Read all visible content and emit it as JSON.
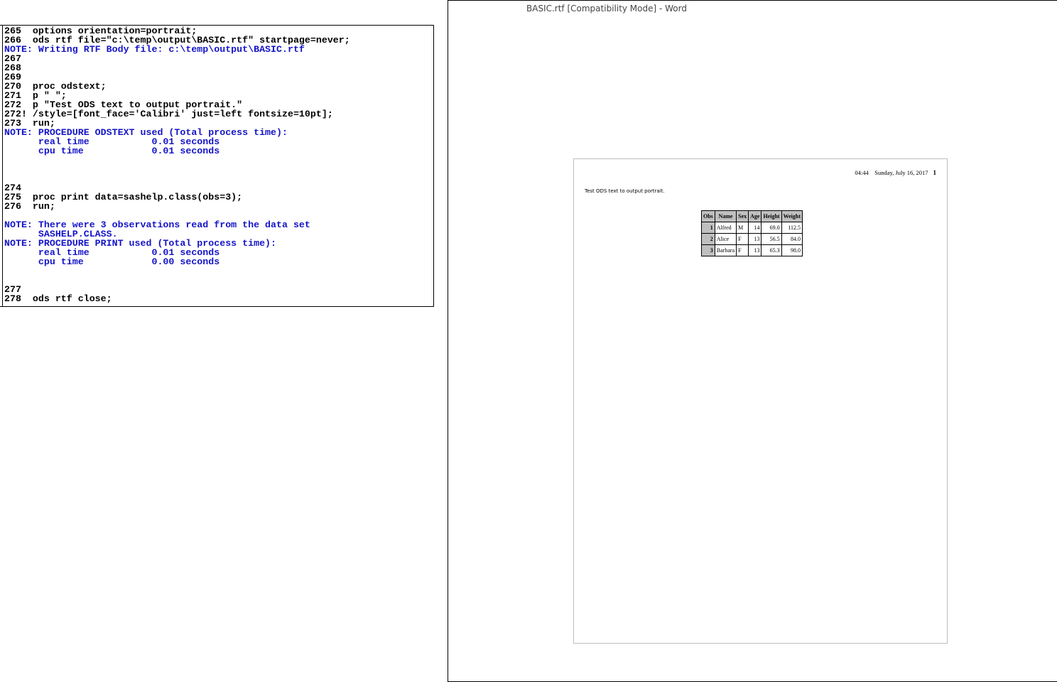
{
  "log": {
    "lines": [
      {
        "text": "265  options orientation=portrait;",
        "type": "code"
      },
      {
        "text": "266  ods rtf file=\"c:\\temp\\output\\BASIC.rtf\" startpage=never;",
        "type": "code"
      },
      {
        "text": "NOTE: Writing RTF Body file: c:\\temp\\output\\BASIC.rtf",
        "type": "note"
      },
      {
        "text": "267",
        "type": "code"
      },
      {
        "text": "268",
        "type": "code"
      },
      {
        "text": "269",
        "type": "code"
      },
      {
        "text": "270  proc odstext;",
        "type": "code"
      },
      {
        "text": "271  p \" \";",
        "type": "code"
      },
      {
        "text": "272  p \"Test ODS text to output portrait.\"",
        "type": "code"
      },
      {
        "text": "272! /style=[font_face='Calibri' just=left fontsize=10pt];",
        "type": "code"
      },
      {
        "text": "273  run;",
        "type": "code"
      },
      {
        "text": "NOTE: PROCEDURE ODSTEXT used (Total process time):",
        "type": "note"
      },
      {
        "text": "      real time           0.01 seconds",
        "type": "note"
      },
      {
        "text": "      cpu time            0.01 seconds",
        "type": "note"
      },
      {
        "text": "",
        "type": "code"
      },
      {
        "text": "",
        "type": "code"
      },
      {
        "text": "",
        "type": "code"
      },
      {
        "text": "274",
        "type": "code"
      },
      {
        "text": "275  proc print data=sashelp.class(obs=3);",
        "type": "code"
      },
      {
        "text": "276  run;",
        "type": "code"
      },
      {
        "text": "",
        "type": "code"
      },
      {
        "text": "NOTE: There were 3 observations read from the data set",
        "type": "note"
      },
      {
        "text": "      SASHELP.CLASS.",
        "type": "note"
      },
      {
        "text": "NOTE: PROCEDURE PRINT used (Total process time):",
        "type": "note"
      },
      {
        "text": "      real time           0.01 seconds",
        "type": "note"
      },
      {
        "text": "      cpu time            0.00 seconds",
        "type": "note"
      },
      {
        "text": "",
        "type": "code"
      },
      {
        "text": "",
        "type": "code"
      },
      {
        "text": "277",
        "type": "code"
      },
      {
        "text": "278  ods rtf close;",
        "type": "code"
      }
    ]
  },
  "word": {
    "title": "BASIC.rtf [Compatibility Mode] - Word",
    "header_time": "04:44",
    "header_date": "Sunday, July 16, 2017",
    "page_number": "1",
    "body_text": "Test ODS text to output portrait.",
    "table": {
      "columns": [
        "Obs",
        "Name",
        "Sex",
        "Age",
        "Height",
        "Weight"
      ],
      "rows": [
        [
          "1",
          "Alfred",
          "M",
          "14",
          "69.0",
          "112.5"
        ],
        [
          "2",
          "Alice",
          "F",
          "13",
          "56.5",
          "84.0"
        ],
        [
          "3",
          "Barbara",
          "F",
          "13",
          "65.3",
          "98.0"
        ]
      ]
    }
  },
  "colors": {
    "note_text": "#1414c8",
    "code_text": "#000000",
    "header_fill": "#bfbfbf"
  }
}
